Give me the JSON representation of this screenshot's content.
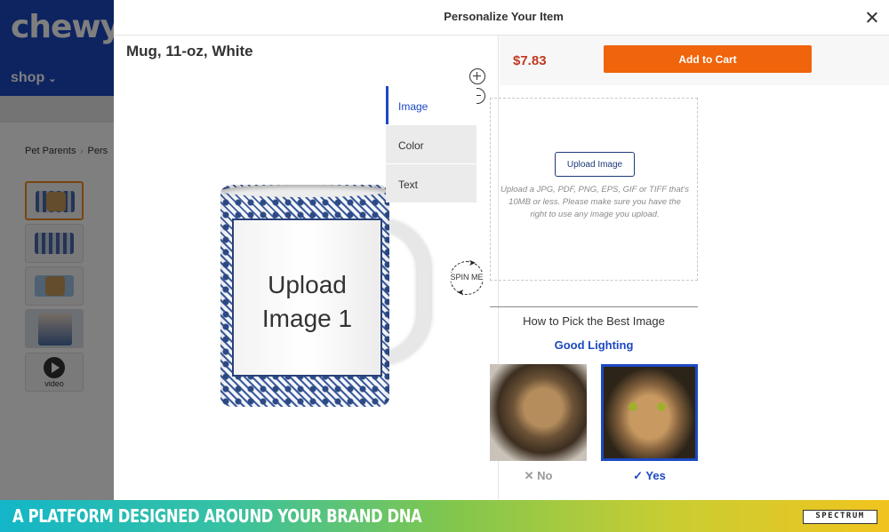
{
  "background_page": {
    "logo": "chewy",
    "shop_label": "shop",
    "breadcrumb": [
      "Pet Parents",
      "Pers"
    ],
    "thumbnails": [
      "mug-front",
      "mug-wrap",
      "mug-side",
      "lifestyle-photo",
      "video"
    ],
    "video_label": "video"
  },
  "modal": {
    "title": "Personalize Your Item",
    "close_icon": "close-icon"
  },
  "product": {
    "name": "Mug, 11-oz, White",
    "zoom_in_icon": "plus-circle-icon",
    "zoom_out_icon": "minus-circle-icon",
    "upload_placeholder_line1": "Upload",
    "upload_placeholder_line2": "Image 1",
    "spin_label": "SPIN ME"
  },
  "purchase": {
    "price": "$7.83",
    "price_color": "#c0391f",
    "add_to_cart_label": "Add to Cart",
    "add_to_cart_color": "#f0640b"
  },
  "tabs": [
    {
      "label": "Image",
      "active": true
    },
    {
      "label": "Color",
      "active": false
    },
    {
      "label": "Text",
      "active": false
    }
  ],
  "upload": {
    "button_label": "Upload Image",
    "hint": "Upload a JPG, PDF, PNG, EPS, GIF or TIFF that's 10MB or less. Please make sure you have the right to use any image you upload."
  },
  "tips": {
    "title": "How to Pick the Best Image",
    "subtitle": "Good Lighting",
    "no_label": "No",
    "yes_label": "Yes",
    "accent_color": "#1c49c2"
  },
  "banner": {
    "text": "A PLATFORM DESIGNED AROUND YOUR BRAND DNA",
    "brand": "SPECTRUM"
  }
}
